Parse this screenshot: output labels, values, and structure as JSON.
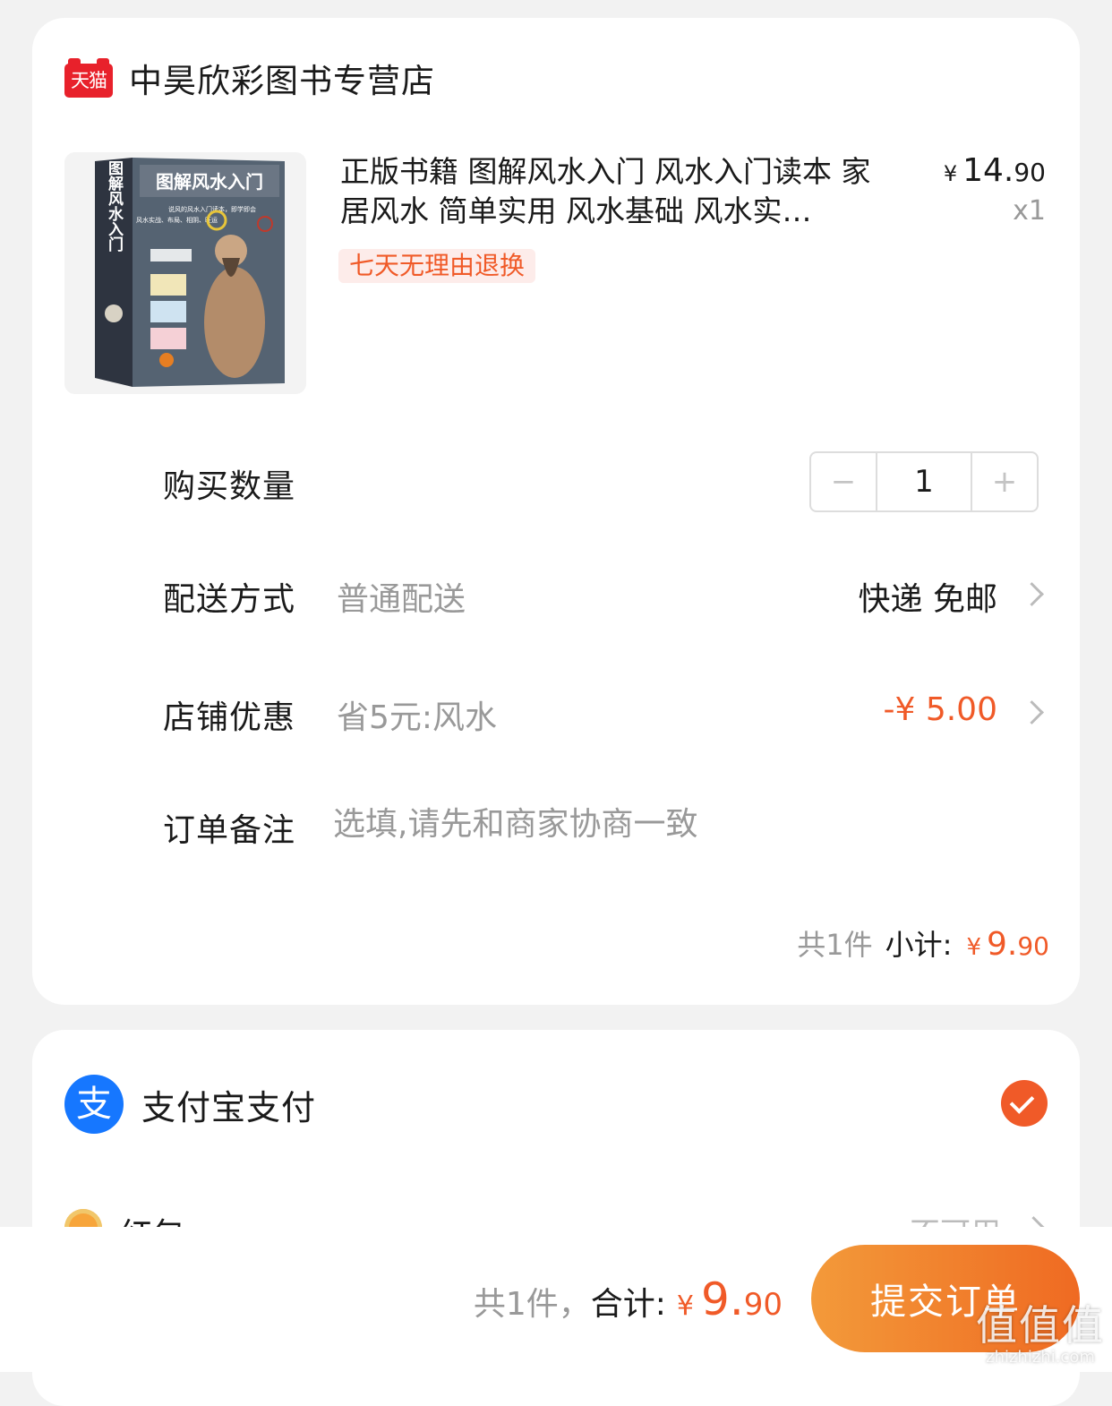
{
  "shop": {
    "logo_text": "天猫",
    "name": "中昊欣彩图书专营店"
  },
  "product": {
    "title": "正版书籍 图解风水入门 风水入门读本 家居风水 简单实用 风水基础 风水实…",
    "price_currency": "¥",
    "price_int": "14.",
    "price_dec": "90",
    "quantity": "x1",
    "return_tag": "七天无理由退换",
    "cover": {
      "title": "图解风水入门",
      "side_title": "图解风水入门",
      "subtitle": "说风的风水入门读本，即学即会",
      "subtitle2": "风水实战、布局、相阴、旺运"
    }
  },
  "rows": {
    "quantity_label": "购买数量",
    "quantity_value": "1",
    "minus": "−",
    "plus": "+",
    "shipping_label": "配送方式",
    "shipping_sub": "普通配送",
    "shipping_value": "快递 免邮",
    "discount_label": "店铺优惠",
    "discount_sub": "省5元:风水",
    "discount_value": "-¥ 5.00",
    "remark_label": "订单备注",
    "remark_placeholder": "选填,请先和商家协商一致"
  },
  "subtotal": {
    "count": "共1件",
    "label": "小计:",
    "currency": "¥",
    "int": "9.",
    "dec": "90"
  },
  "payment": {
    "logo_text": "支",
    "method": "支付宝支付",
    "redpack_label": "红包",
    "redpack_value": "不可用"
  },
  "footer": {
    "count": "共1件，",
    "label": "合计:",
    "currency": "¥",
    "int": "9.",
    "dec": "90",
    "submit": "提交订单",
    "watermark_big": "值值值",
    "watermark_small": "zhizhizhi.com"
  },
  "colors": {
    "accent": "#f05a28",
    "tmall_red": "#e8212b",
    "alipay_blue": "#1677ff"
  }
}
